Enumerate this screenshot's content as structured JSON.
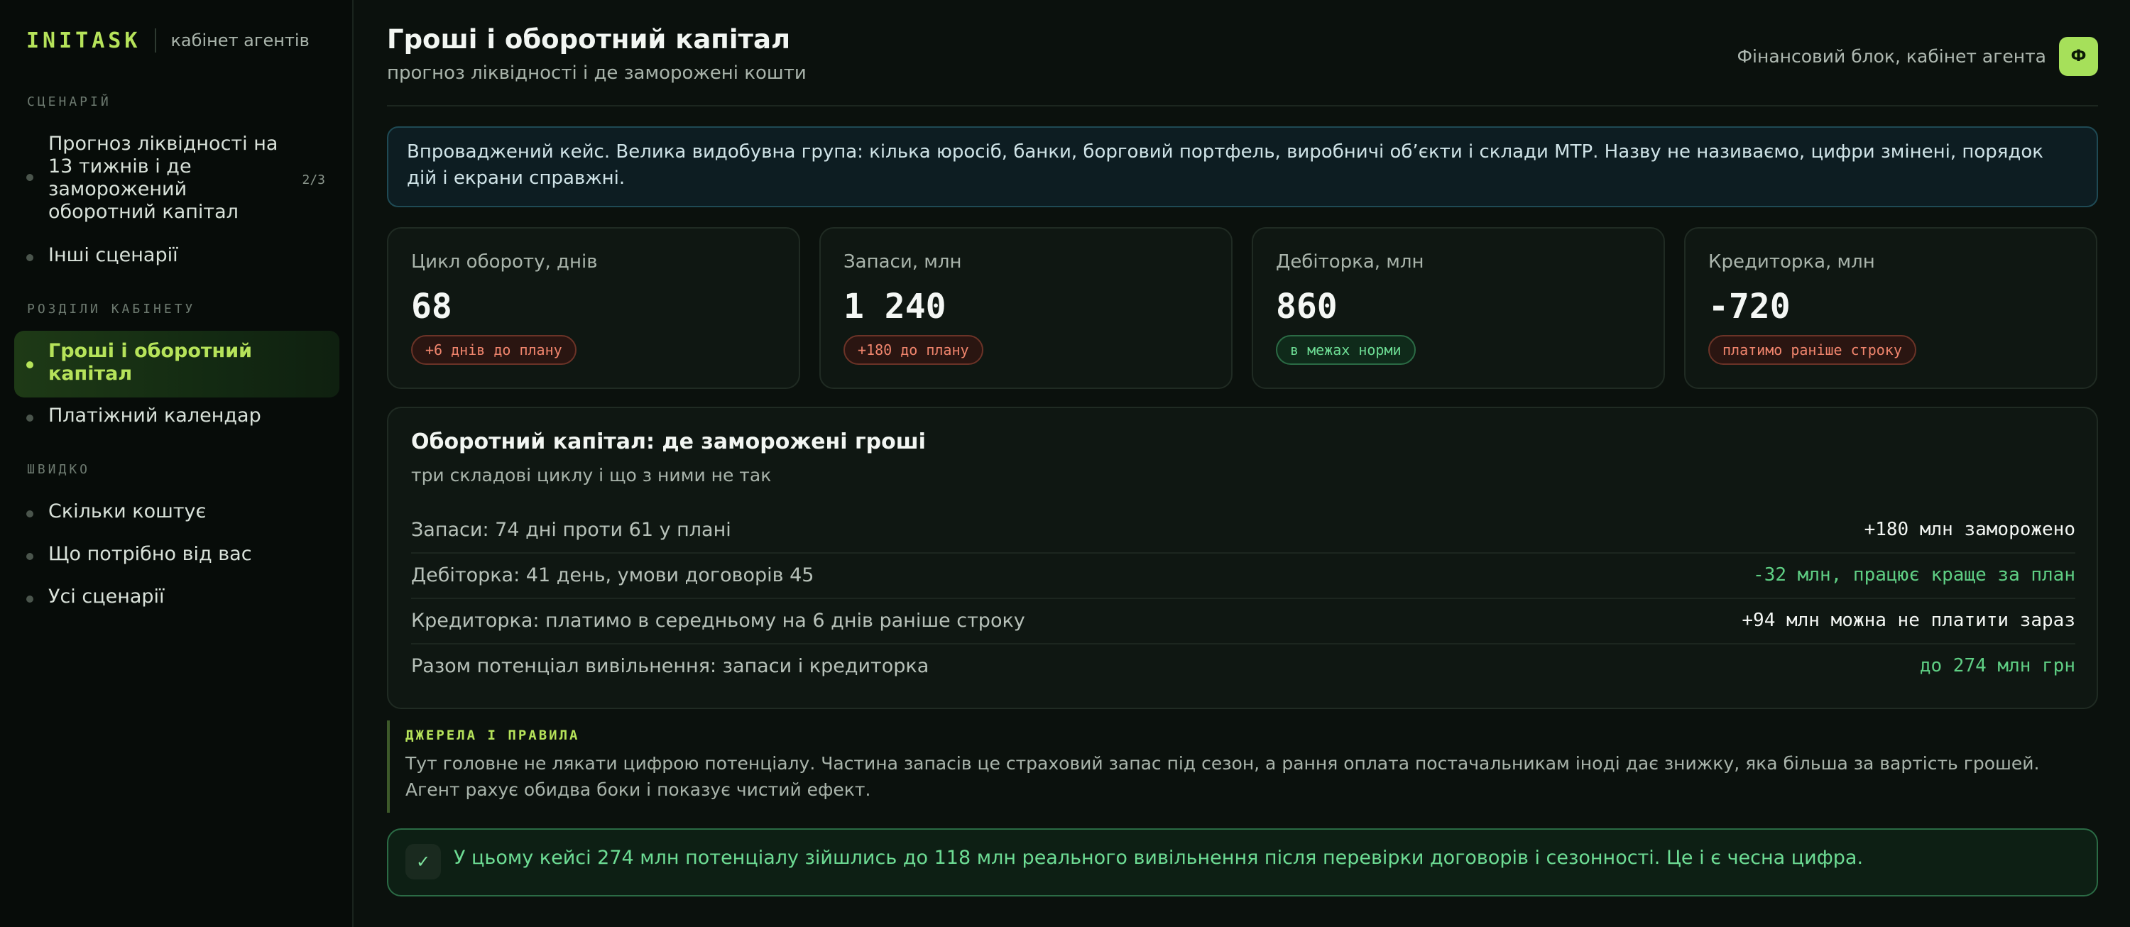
{
  "brand": {
    "logo": "INITASK",
    "subtitle": "кабінет агентів"
  },
  "sidebar": {
    "scenarios_heading": "СЦЕНАРІЙ",
    "scenarios": [
      {
        "label": "Прогноз ліквідності на 13 тижнів і де заморожений оборотний капітал",
        "count": "2/3"
      },
      {
        "label": "Інші сценарії"
      }
    ],
    "sections_heading": "РОЗДІЛИ КАБІНЕТУ",
    "sections": [
      {
        "label": "Гроші і оборотний капітал",
        "active": true
      },
      {
        "label": "Платіжний календар"
      }
    ],
    "quick_heading": "ШВИДКО",
    "quick": [
      {
        "label": "Скільки коштує"
      },
      {
        "label": "Що потрібно від вас"
      },
      {
        "label": "Усі сценарії"
      }
    ]
  },
  "header": {
    "title": "Гроші і оборотний капітал",
    "subtitle": "прогноз ліквідності і де заморожені кошти",
    "context": "Фінансовий блок, кабінет агента",
    "avatar": "Ф"
  },
  "intro": "Впроваджений кейс. Велика видобувна група: кілька юросіб, банки, борговий портфель, виробничі об’єкти і склади МТР. Назву не називаємо, цифри змінені, порядок дій і екрани справжні.",
  "kpis": [
    {
      "label": "Цикл обороту, днів",
      "value": "68",
      "badge": "+6 днів до плану",
      "status": "bad"
    },
    {
      "label": "Запаси, млн",
      "value": "1 240",
      "badge": "+180 до плану",
      "status": "bad"
    },
    {
      "label": "Дебіторка, млн",
      "value": "860",
      "badge": "в межах норми",
      "status": "good"
    },
    {
      "label": "Кредиторка, млн",
      "value": "-720",
      "badge": "платимо раніше строку",
      "status": "bad"
    }
  ],
  "working_capital": {
    "title": "Оборотний капітал: де заморожені гроші",
    "subtitle": "три складові циклу і що з ними не так",
    "rows": [
      {
        "label": "Запаси: 74 дні проти 61 у плані",
        "value": "+180 млн заморожено"
      },
      {
        "label": "Дебіторка: 41 день, умови договорів 45",
        "value": "-32 млн, працює краще за план"
      },
      {
        "label": "Кредиторка: платимо в середньому на 6 днів раніше строку",
        "value": "+94 млн можна не платити зараз"
      },
      {
        "label": "Разом потенціал вивільнення: запаси і кредиторка",
        "value": "до 274 млн грн"
      }
    ]
  },
  "rules": {
    "heading": "ДЖЕРЕЛА І ПРАВИЛА",
    "text": "Тут головне не лякати цифрою потенціалу. Частина запасів це страховий запас під сезон, а рання оплата постачальникам іноді дає знижку, яка більша за вартість грошей. Агент рахує обидва боки і показує чистий ефект."
  },
  "result": {
    "icon": "check-icon",
    "glyph": "✓",
    "text": "У цьому кейсі 274 млн потенціалу зійшлись до 118 млн реального вивільнення після перевірки договорів і сезонності. Це і є чесна цифра."
  },
  "colors": {
    "accent": "#b6e35a",
    "good": "#6ddc94",
    "bad": "#f0856d",
    "background": "#0b110d"
  }
}
